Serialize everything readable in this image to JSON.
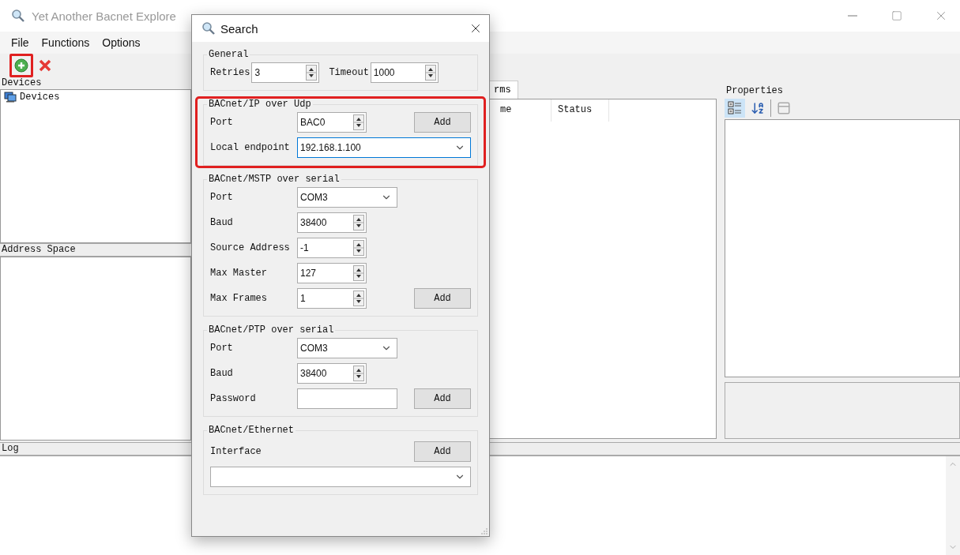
{
  "window": {
    "title": "Yet Another Bacnet Explore"
  },
  "menu": [
    {
      "label": "File"
    },
    {
      "label": "Functions"
    },
    {
      "label": "Options"
    }
  ],
  "toolbar": [
    {
      "kind": "add",
      "highlighted": true
    },
    {
      "kind": "remove",
      "highlighted": false
    }
  ],
  "devices": {
    "title": "Devices",
    "items": [
      {
        "label": "Devices"
      }
    ]
  },
  "address_space": {
    "title": "Address Space"
  },
  "center": {
    "tabs": [
      {
        "label": "rms",
        "selected": true
      }
    ],
    "columns": [
      "me",
      "Status"
    ]
  },
  "properties": {
    "title": "Properties",
    "tools": [
      {
        "kind": "categorized",
        "selected": true
      },
      {
        "kind": "alphabetical",
        "selected": false
      },
      {
        "kind": "pages",
        "selected": false
      }
    ]
  },
  "log": {
    "title": "Log"
  },
  "dialog": {
    "title": "Search",
    "groups": [
      {
        "title": "General",
        "kind": "inline",
        "highlighted": false,
        "fields": [
          {
            "label": "Retries",
            "kind": "spin",
            "value": "3",
            "focused": false
          },
          {
            "label": "Timeout",
            "kind": "spin",
            "value": "1000",
            "focused": false
          }
        ]
      },
      {
        "title": "BACnet/IP over Udp",
        "kind": "form",
        "highlighted": true,
        "fields": [
          {
            "label": "Port",
            "kind": "spin",
            "value": "BAC0",
            "focused": false,
            "button": "Add"
          },
          {
            "label": "Local endpoint",
            "kind": "combo",
            "value": "192.168.1.100",
            "focused": true
          }
        ]
      },
      {
        "title": "BACnet/MSTP over serial",
        "kind": "form",
        "highlighted": false,
        "fields": [
          {
            "label": "Port",
            "kind": "combo",
            "value": "COM3",
            "focused": false
          },
          {
            "label": "Baud",
            "kind": "spin",
            "value": "38400",
            "focused": false
          },
          {
            "label": "Source Address",
            "kind": "spin",
            "value": "-1",
            "focused": false
          },
          {
            "label": "Max Master",
            "kind": "spin",
            "value": "127",
            "focused": false
          },
          {
            "label": "Max Frames",
            "kind": "spin",
            "value": "1",
            "focused": false,
            "button": "Add"
          }
        ]
      },
      {
        "title": "BACnet/PTP over serial",
        "kind": "form",
        "highlighted": false,
        "fields": [
          {
            "label": "Port",
            "kind": "combo",
            "value": "COM3",
            "focused": false
          },
          {
            "label": "Baud",
            "kind": "spin",
            "value": "38400",
            "focused": false
          },
          {
            "label": "Password",
            "kind": "text",
            "focused": false,
            "button": "Add"
          }
        ]
      },
      {
        "title": "BACnet/Ethernet",
        "kind": "stacked",
        "highlighted": false,
        "fields": [
          {
            "label": "Interface",
            "kind": "combo",
            "focused": false,
            "button": "Add"
          }
        ]
      }
    ]
  }
}
